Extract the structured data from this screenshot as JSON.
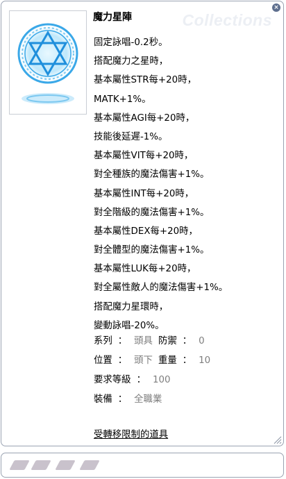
{
  "window": {
    "watermark": "Collections",
    "close_glyph": "×",
    "title": "魔力星陣"
  },
  "item_icon": "magic-hexagram-icon",
  "description": [
    "固定詠唱-0.2秒。",
    "搭配魔力之星時，",
    "基本屬性STR每+20時，",
    "MATK+1%。",
    "基本屬性AGI每+20時，",
    "技能後延遲-1%。",
    "基本屬性VIT每+20時，",
    "對全種族的魔法傷害+1%。",
    "基本屬性INT每+20時，",
    "對全階級的魔法傷害+1%。",
    "基本屬性DEX每+20時，",
    "對全體型的魔法傷害+1%。",
    "基本屬性LUK每+20時，",
    "對全屬性敵人的魔法傷害+1%。",
    "搭配魔力星環時，",
    "變動詠唱-20%。"
  ],
  "properties": {
    "series_key": "系列",
    "series_val": "頭具",
    "defense_key": "防禦",
    "defense_val": "0",
    "position_key": "位置",
    "position_val": "頭下",
    "weight_key": "重量",
    "weight_val": "10",
    "level_key": "要求等級",
    "level_val": "100",
    "equip_key": "裝備",
    "equip_val": "全職業",
    "colon": "："
  },
  "restriction_link": "受轉移限制的道具",
  "card_slots": 4,
  "colors": {
    "border": "#9aa3b2",
    "value_gray": "#7e7e7e",
    "slot": "#c9c2cc",
    "star_blue": "#3aa8e8"
  }
}
